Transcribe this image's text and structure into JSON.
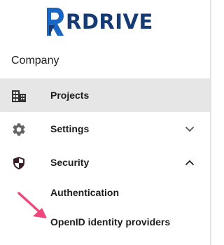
{
  "brand": {
    "name": "RDRIVE",
    "colors": {
      "logo_blue": "#1967c2",
      "logo_dark": "#163a73",
      "accent_arrow": "#f0467a"
    }
  },
  "company_label": "Company",
  "nav": {
    "projects": {
      "label": "Projects",
      "icon": "building-icon",
      "active": true
    },
    "settings": {
      "label": "Settings",
      "icon": "gear-icon",
      "expanded": false
    },
    "security": {
      "label": "Security",
      "icon": "shield-icon",
      "expanded": true,
      "children": [
        "Authentication",
        "OpenID identity providers"
      ]
    }
  }
}
